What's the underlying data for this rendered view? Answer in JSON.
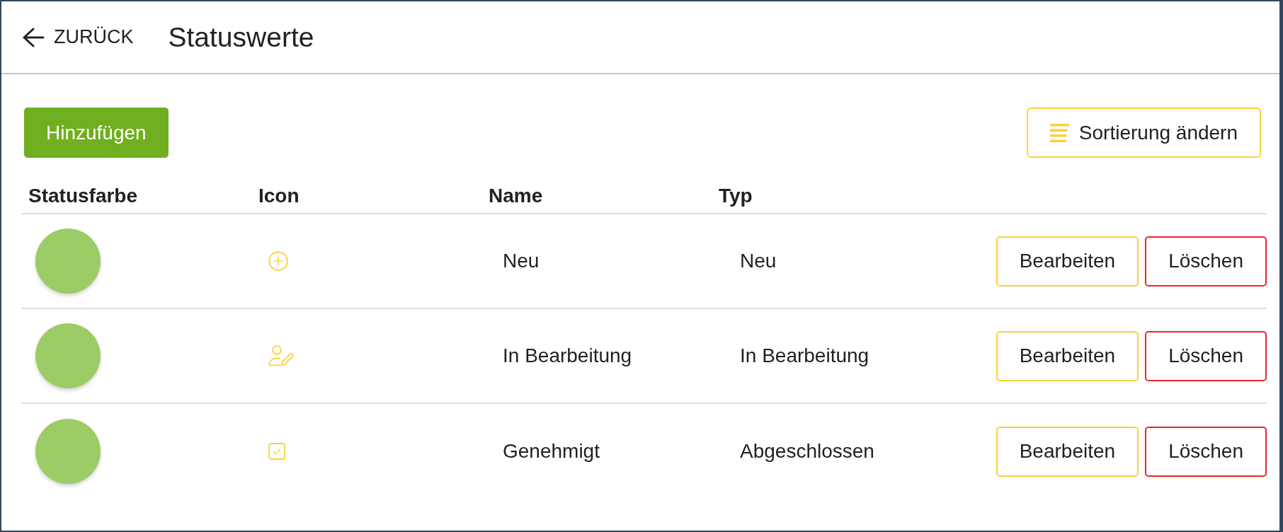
{
  "header": {
    "back_label": "ZURÜCK",
    "title": "Statuswerte"
  },
  "toolbar": {
    "add_button": "Hinzufügen",
    "sort_button": "Sortierung ändern"
  },
  "table": {
    "columns": [
      "Statusfarbe",
      "Icon",
      "Name",
      "Typ"
    ],
    "rows": [
      {
        "color": "#9ccc65",
        "kind": "plus",
        "name": "Neu",
        "type": "Neu",
        "actions": [
          {
            "label": "Bearbeiten",
            "kind": "edit"
          },
          {
            "label": "Löschen",
            "kind": "delete"
          }
        ]
      },
      {
        "color": "#9ccc65",
        "kind": "user",
        "name": "In Bearbeitung",
        "type": "In Bearbeitung",
        "actions": [
          {
            "label": "Bearbeiten",
            "kind": "edit"
          },
          {
            "label": "Löschen",
            "kind": "delete"
          }
        ]
      },
      {
        "color": "#9ccc65",
        "kind": "check",
        "name": "Genehmigt",
        "type": "Abgeschlossen",
        "actions": [
          {
            "label": "Bearbeiten",
            "kind": "edit"
          },
          {
            "label": "Löschen",
            "kind": "delete"
          }
        ]
      }
    ]
  }
}
